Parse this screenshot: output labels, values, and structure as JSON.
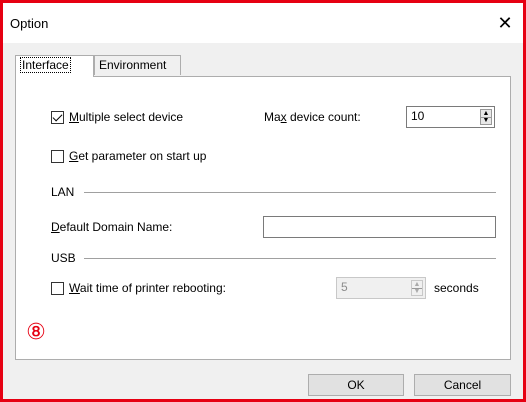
{
  "window": {
    "title": "Option"
  },
  "tabs": [
    {
      "label": "Interface",
      "active": true
    },
    {
      "label": "Environment",
      "active": false
    }
  ],
  "interface": {
    "multiple_select": {
      "label_prefix": "M",
      "label_rest": "ultiple select device",
      "checked": true
    },
    "max_device": {
      "label_pre": "Ma",
      "label_u": "x",
      "label_post": " device count:",
      "value": "10"
    },
    "get_param": {
      "label_prefix": "G",
      "label_rest": "et parameter on start up",
      "checked": false
    },
    "lan": {
      "group_label": "LAN",
      "domain_label_prefix": "D",
      "domain_label_rest": "efault Domain Name:",
      "domain_value": ""
    },
    "usb": {
      "group_label": "USB",
      "wait_label_prefix": "W",
      "wait_label_rest": "ait time of printer rebooting:",
      "wait_checked": false,
      "wait_value": "5",
      "seconds_label": "seconds"
    }
  },
  "annotation": {
    "marker": "⑧",
    "color": "#e60012"
  },
  "buttons": {
    "ok": "OK",
    "cancel": "Cancel"
  }
}
